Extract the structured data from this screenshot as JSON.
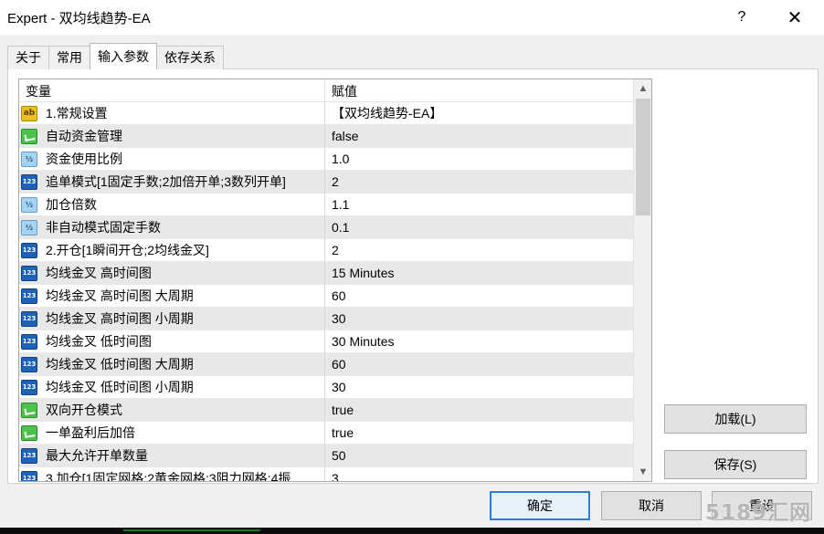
{
  "window": {
    "title": "Expert - 双均线趋势-EA",
    "help": "?",
    "close": "✕"
  },
  "tabs": [
    {
      "label": "关于",
      "active": false
    },
    {
      "label": "常用",
      "active": false
    },
    {
      "label": "输入参数",
      "active": true
    },
    {
      "label": "依存关系",
      "active": false
    }
  ],
  "grid": {
    "headers": {
      "variable": "变量",
      "value": "赋值"
    },
    "rows": [
      {
        "icon": "ab",
        "icon_text": "ab",
        "variable": "1.常规设置",
        "value": "【双均线趋势-EA】"
      },
      {
        "icon": "bool",
        "icon_text": "",
        "variable": "自动资金管理",
        "value": "false"
      },
      {
        "icon": "half",
        "icon_text": "½",
        "variable": "资金使用比例",
        "value": "1.0"
      },
      {
        "icon": "num",
        "icon_text": "123",
        "variable": "追单模式[1固定手数;2加倍开单;3数列开单]",
        "value": "2"
      },
      {
        "icon": "half",
        "icon_text": "½",
        "variable": "加仓倍数",
        "value": "1.1"
      },
      {
        "icon": "half",
        "icon_text": "½",
        "variable": "非自动模式固定手数",
        "value": "0.1"
      },
      {
        "icon": "num",
        "icon_text": "123",
        "variable": "2.开仓[1瞬间开仓;2均线金叉]",
        "value": "2"
      },
      {
        "icon": "num",
        "icon_text": "123",
        "variable": "均线金叉 高时间图",
        "value": "15 Minutes"
      },
      {
        "icon": "num",
        "icon_text": "123",
        "variable": "均线金叉 高时间图 大周期",
        "value": "60"
      },
      {
        "icon": "num",
        "icon_text": "123",
        "variable": "均线金叉 高时间图 小周期",
        "value": "30"
      },
      {
        "icon": "num",
        "icon_text": "123",
        "variable": "均线金叉 低时间图",
        "value": "30 Minutes"
      },
      {
        "icon": "num",
        "icon_text": "123",
        "variable": "均线金叉 低时间图 大周期",
        "value": "60"
      },
      {
        "icon": "num",
        "icon_text": "123",
        "variable": "均线金叉 低时间图 小周期",
        "value": "30"
      },
      {
        "icon": "bool",
        "icon_text": "",
        "variable": "双向开仓模式",
        "value": "true"
      },
      {
        "icon": "bool",
        "icon_text": "",
        "variable": "一单盈利后加倍",
        "value": "true"
      },
      {
        "icon": "num",
        "icon_text": "123",
        "variable": "最大允许开单数量",
        "value": "50"
      },
      {
        "icon": "num",
        "icon_text": "123",
        "variable": "3.加仓[1固定网格;2黄金网格;3阻力网格;4振",
        "value": "3"
      }
    ],
    "scroll": {
      "up": "▲",
      "down": "▼"
    }
  },
  "buttons": {
    "load": "加载(L)",
    "save": "保存(S)",
    "ok": "确定",
    "cancel": "取消",
    "reset": "重设"
  },
  "watermark": "5189汇网",
  "colors": {
    "accent": "#2f7bd6",
    "row_shade": "#e8e8e8",
    "icon_string": "#e9c01e",
    "icon_bool": "#4cc24c",
    "icon_double": "#a6d3f2",
    "icon_int": "#1e63b8"
  }
}
